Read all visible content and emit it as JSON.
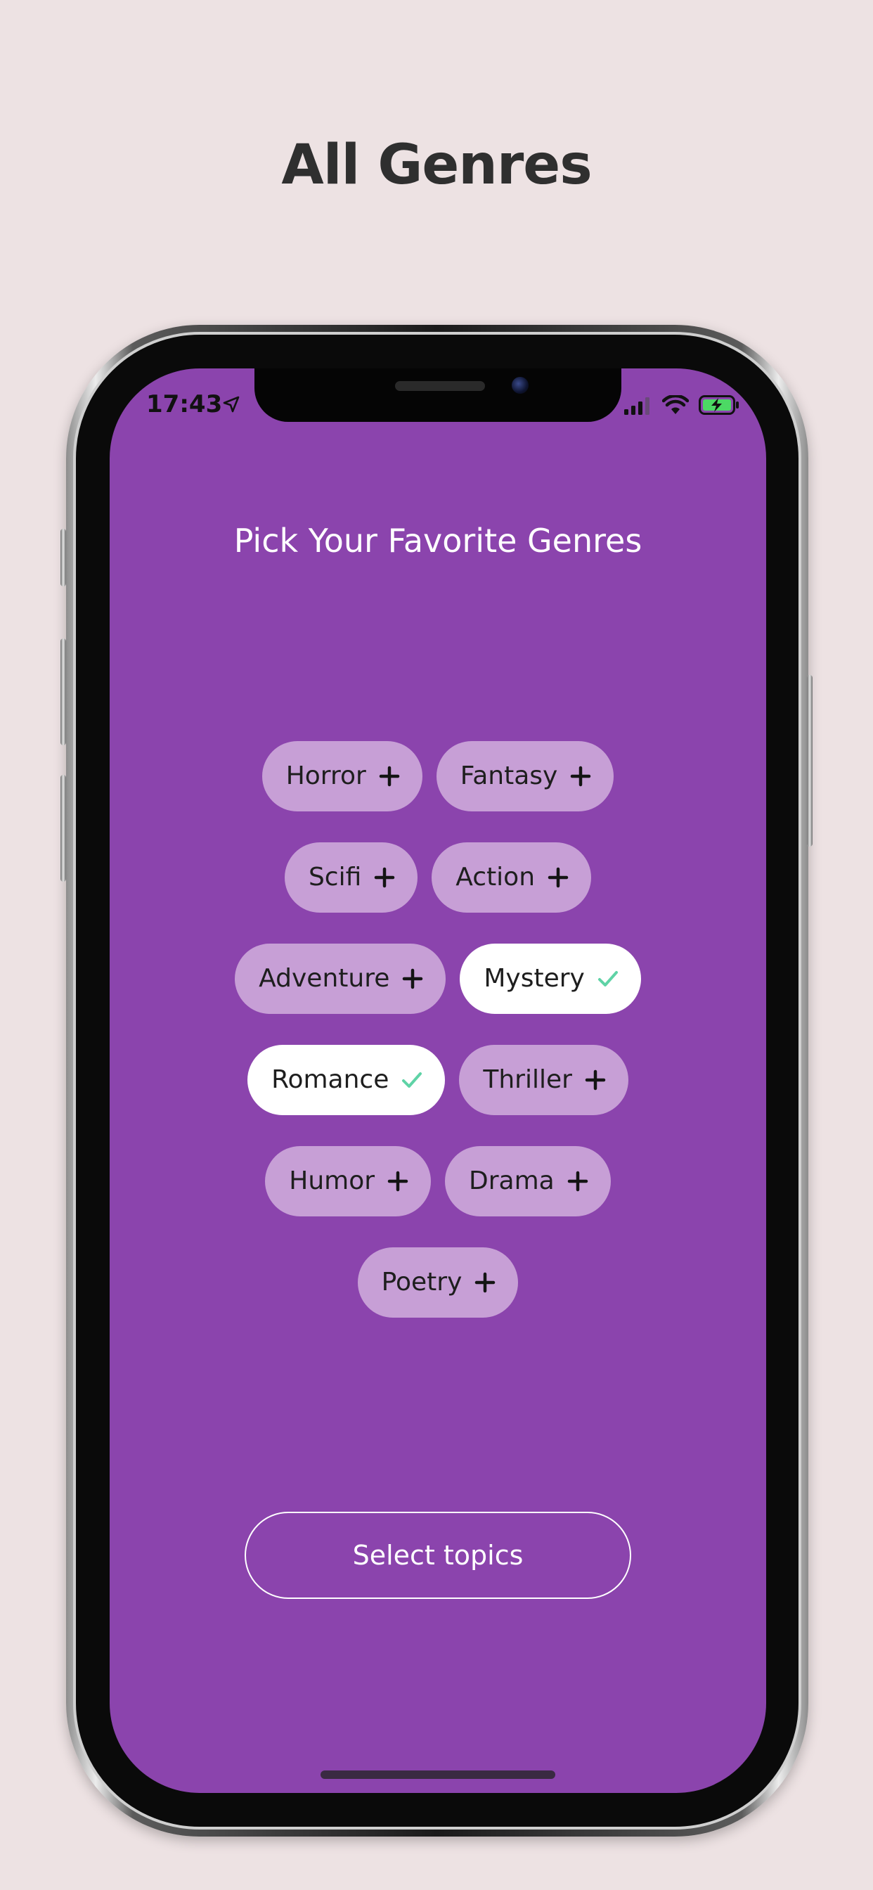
{
  "page": {
    "heading": "All Genres"
  },
  "status_bar": {
    "time": "17:43",
    "icons": [
      "location-arrow-icon",
      "cellular-signal-icon",
      "wifi-icon",
      "battery-charging-icon"
    ]
  },
  "screen": {
    "title": "Pick Your Favorite Genres",
    "background_color": "#8b44ad",
    "chip_color": "#c79fd6",
    "selected_chip_color": "#ffffff",
    "check_color": "#5fd3a6",
    "rows": [
      [
        {
          "label": "Horror",
          "selected": false
        },
        {
          "label": "Fantasy",
          "selected": false
        }
      ],
      [
        {
          "label": "Scifi",
          "selected": false
        },
        {
          "label": "Action",
          "selected": false
        }
      ],
      [
        {
          "label": "Adventure",
          "selected": false
        },
        {
          "label": "Mystery",
          "selected": true
        }
      ],
      [
        {
          "label": "Romance",
          "selected": true
        },
        {
          "label": "Thriller",
          "selected": false
        }
      ],
      [
        {
          "label": "Humor",
          "selected": false
        },
        {
          "label": "Drama",
          "selected": false
        }
      ],
      [
        {
          "label": "Poetry",
          "selected": false
        }
      ]
    ],
    "button_label": "Select topics"
  }
}
